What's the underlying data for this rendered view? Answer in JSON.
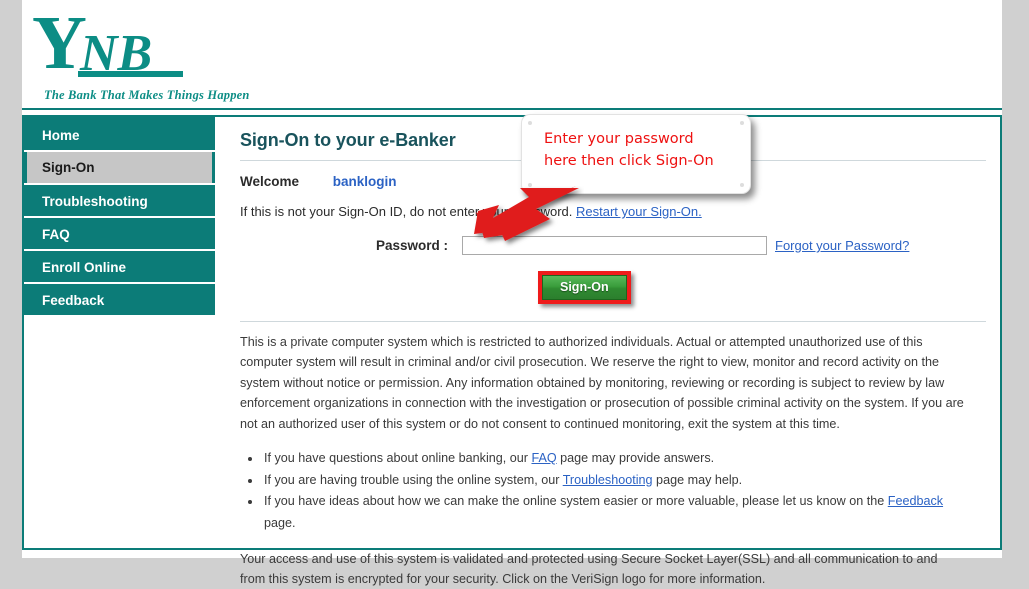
{
  "brand": {
    "logo_text": "YNB",
    "tagline": "The Bank That Makes Things Happen",
    "logo_color": "#0c8d85"
  },
  "sidebar": {
    "items": [
      {
        "label": "Home",
        "selected": false
      },
      {
        "label": "Sign-On",
        "selected": true
      },
      {
        "label": "Troubleshooting",
        "selected": false
      },
      {
        "label": "FAQ",
        "selected": false
      },
      {
        "label": "Enroll Online",
        "selected": false
      },
      {
        "label": "Feedback",
        "selected": false
      }
    ]
  },
  "main": {
    "page_title": "Sign-On to your e-Banker",
    "welcome_label": "Welcome",
    "username": "banklogin",
    "notice_text": "If this is not your Sign-On ID, do not enter your Password.",
    "restart_link": "Restart your Sign-On.",
    "password_label": "Password :",
    "password_value": "",
    "password_placeholder": "",
    "forgot_link": "Forgot your Password?",
    "signon_button": "Sign-On",
    "legal_paragraph": "This is a private computer system which is restricted to authorized individuals. Actual or attempted unauthorized use of this computer system will result in criminal and/or civil prosecution. We reserve the right to view, monitor and record activity on the system without notice or permission. Any information obtained by monitoring, reviewing or recording is subject to review by law enforcement organizations in connection with the investigation or prosecution of possible criminal activity on the system. If you are not an authorized user of this system or do not consent to continued monitoring, exit the system at this time.",
    "tips": [
      {
        "before": "If you have questions about online banking, our ",
        "link": "FAQ",
        "after": " page may provide answers."
      },
      {
        "before": "If you are having trouble using the online system, our ",
        "link": "Troubleshooting",
        "after": " page may help."
      },
      {
        "before": "If you have ideas about how we can make the online system easier or more valuable, please let us know on the ",
        "link": "Feedback",
        "after": " page."
      }
    ],
    "ssl_paragraph": "Your access and use of this system is validated and protected using Secure Socket Layer(SSL) and all communication to and from this system is encrypted for your security. Click on the VeriSign logo for more information."
  },
  "annotation": {
    "callout_text": "Enter your password\nhere then click Sign-On",
    "callout_color": "#ee1111",
    "arrow_color": "#e01b1b",
    "highlight_color": "#ef1b1b"
  },
  "colors": {
    "teal": "#0c7c78",
    "link_blue": "#2b62c4",
    "button_green": "#3a9d3c",
    "page_background": "#d0d0d0"
  }
}
